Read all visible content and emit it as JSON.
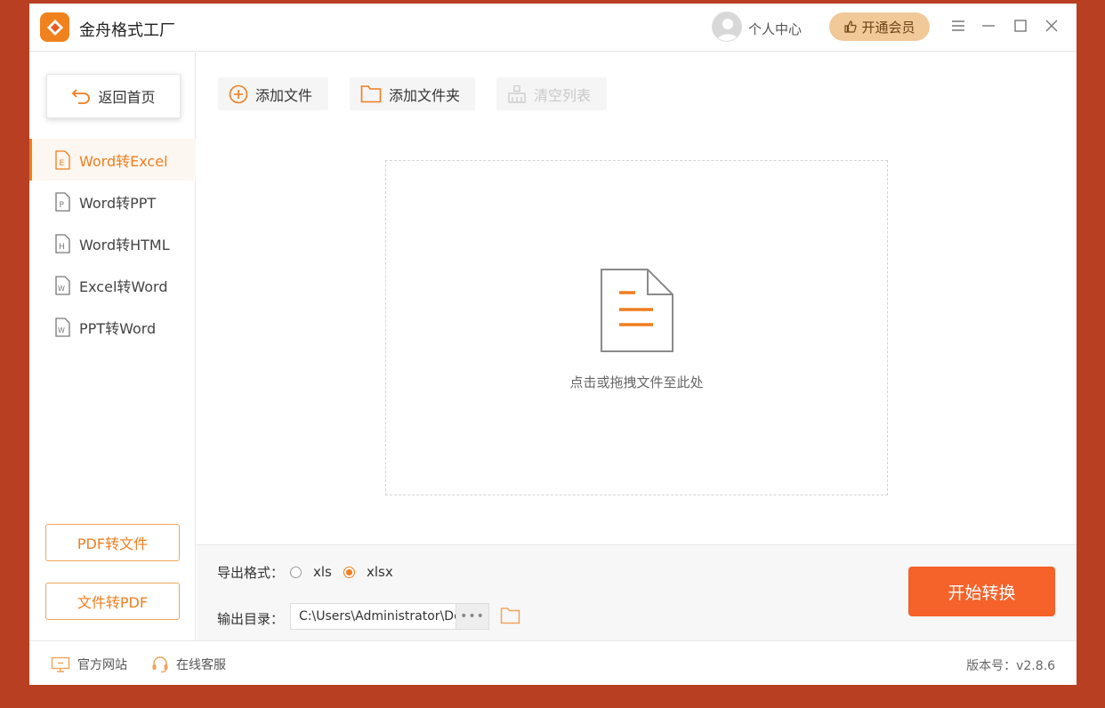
{
  "app": {
    "title": "金舟格式工厂"
  },
  "header": {
    "user_center": "个人中心",
    "vip_label": "开通会员"
  },
  "sidebar": {
    "back_label": "返回首页",
    "items": [
      {
        "label": "Word转Excel",
        "icon": "excel-doc-icon",
        "active": true
      },
      {
        "label": "Word转PPT",
        "icon": "ppt-doc-icon",
        "active": false
      },
      {
        "label": "Word转HTML",
        "icon": "html-doc-icon",
        "active": false
      },
      {
        "label": "Excel转Word",
        "icon": "word-doc-icon",
        "active": false
      },
      {
        "label": "PPT转Word",
        "icon": "word-doc-icon",
        "active": false
      }
    ],
    "pdf_to_file": "PDF转文件",
    "file_to_pdf": "文件转PDF"
  },
  "toolbar": {
    "add_file": "添加文件",
    "add_folder": "添加文件夹",
    "clear_list": "清空列表"
  },
  "dropzone": {
    "hint": "点击或拖拽文件至此处"
  },
  "export": {
    "format_label": "导出格式：",
    "options": [
      "xls",
      "xlsx"
    ],
    "selected": "xlsx",
    "dir_label": "输出目录：",
    "dir_value": "C:\\Users\\Administrator\\Desktop",
    "more": "•••"
  },
  "start_button": "开始转换",
  "status": {
    "website": "官方网站",
    "support": "在线客服",
    "version": "版本号：v2.8.6"
  },
  "colors": {
    "accent": "#f07d1e",
    "primary_button": "#f5622a",
    "background": "#b93f23"
  }
}
